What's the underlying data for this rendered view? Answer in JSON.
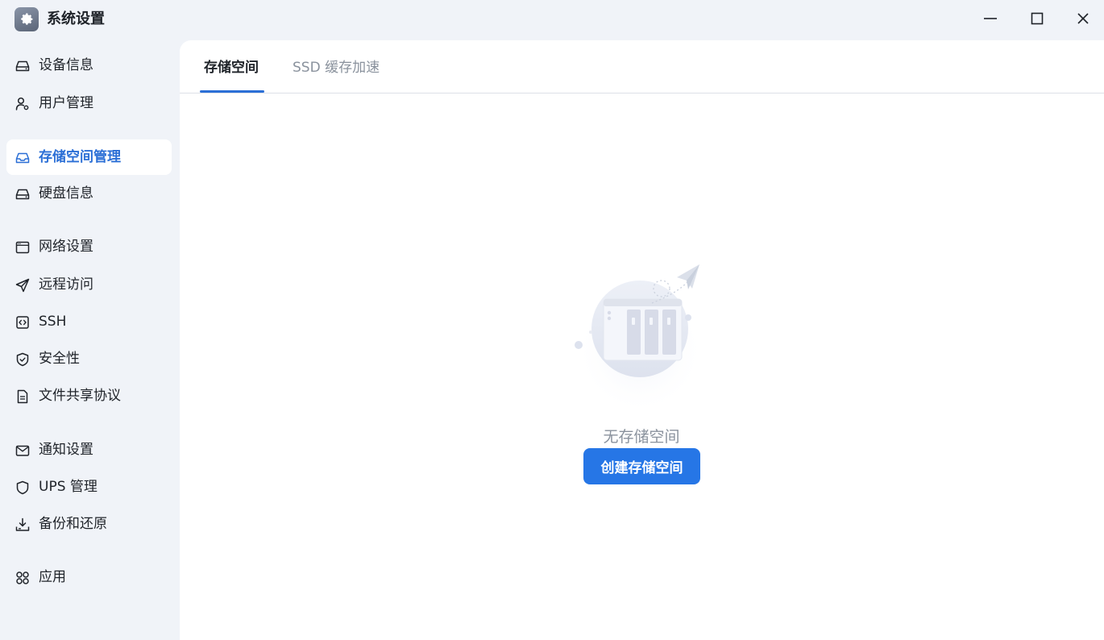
{
  "window": {
    "title": "系统设置",
    "icon": "gear-icon"
  },
  "sidebar": {
    "items": [
      {
        "label": "设备信息",
        "icon": "drive-icon"
      },
      {
        "label": "用户管理",
        "icon": "user-gear-icon"
      },
      {
        "label": "存储空间管理",
        "icon": "inbox-icon",
        "active": true
      },
      {
        "label": "硬盘信息",
        "icon": "drive-icon"
      },
      {
        "label": "网络设置",
        "icon": "browser-window-icon"
      },
      {
        "label": "远程访问",
        "icon": "paper-plane-icon"
      },
      {
        "label": "SSH",
        "icon": "code-icon"
      },
      {
        "label": "安全性",
        "icon": "shield-check-icon"
      },
      {
        "label": "文件共享协议",
        "icon": "document-icon"
      },
      {
        "label": "通知设置",
        "icon": "mail-icon"
      },
      {
        "label": "UPS 管理",
        "icon": "shield-icon"
      },
      {
        "label": "备份和还原",
        "icon": "download-tray-icon"
      },
      {
        "label": "应用",
        "icon": "apps-grid-icon"
      }
    ]
  },
  "main": {
    "tabs": [
      {
        "label": "存储空间",
        "active": true
      },
      {
        "label": "SSD 缓存加速",
        "active": false
      }
    ],
    "empty_state": {
      "text": "无存储空间",
      "button_label": "创建存储空间",
      "illustration": "nas-device-icon"
    }
  },
  "colors": {
    "accent": "#2b6fd6",
    "button": "#2676e6",
    "sidebar_bg": "#f0f3f8",
    "muted_text": "#8a929d"
  }
}
